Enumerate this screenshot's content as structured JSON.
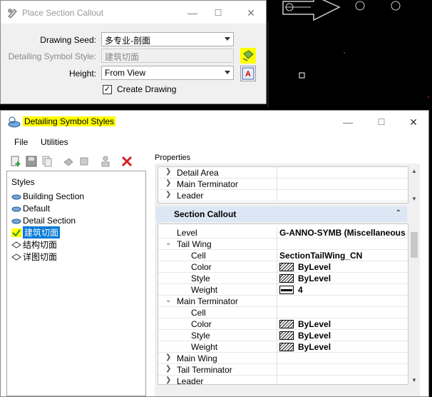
{
  "dialog1": {
    "title": "Place Section Callout",
    "drawing_seed_label": "Drawing Seed:",
    "drawing_seed_value": "多专业-剖面",
    "detailing_style_label": "Detailing Symbol Style:",
    "detailing_style_value": "建筑切面",
    "height_label": "Height:",
    "height_value": "From View",
    "create_drawing_label": "Create Drawing",
    "create_drawing_checked": "✓"
  },
  "dialog2": {
    "title": "Detailing Symbol Styles",
    "menu": [
      "File",
      "Utilities"
    ],
    "styles_label": "Styles",
    "tree": [
      {
        "label": "Building Section"
      },
      {
        "label": "Default"
      },
      {
        "label": "Detail Section"
      },
      {
        "label": "建筑切面"
      },
      {
        "label": "结构切面"
      },
      {
        "label": "详图切面"
      }
    ],
    "properties_label": "Properties",
    "top_rows": [
      "Detail Area",
      "Main Terminator",
      "Leader"
    ],
    "section_title": "Section Callout",
    "rows": [
      {
        "key": "Level",
        "value": "G-ANNO-SYMB (Miscellaneous"
      },
      {
        "key": "Tail Wing",
        "value": ""
      },
      {
        "key": "Cell",
        "value": "SectionTailWing_CN"
      },
      {
        "key": "Color",
        "value": "ByLevel"
      },
      {
        "key": "Style",
        "value": "ByLevel"
      },
      {
        "key": "Weight",
        "value": "4"
      },
      {
        "key": "Main Terminator",
        "value": ""
      },
      {
        "key": "Cell",
        "value": ""
      },
      {
        "key": "Color",
        "value": "ByLevel"
      },
      {
        "key": "Style",
        "value": "ByLevel"
      },
      {
        "key": "Weight",
        "value": "ByLevel"
      },
      {
        "key": "Main Wing",
        "value": ""
      },
      {
        "key": "Tail Terminator",
        "value": ""
      },
      {
        "key": "Leader",
        "value": ""
      }
    ]
  },
  "colors": {
    "highlight": "#ffff00",
    "selection": "#0078d7",
    "section_header": "#dce6f4"
  }
}
